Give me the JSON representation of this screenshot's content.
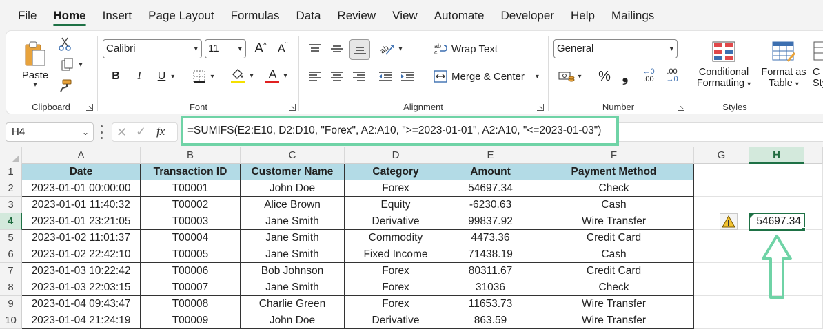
{
  "menu": {
    "items": [
      {
        "label": "File",
        "active": false
      },
      {
        "label": "Home",
        "active": true
      },
      {
        "label": "Insert",
        "active": false
      },
      {
        "label": "Page Layout",
        "active": false
      },
      {
        "label": "Formulas",
        "active": false
      },
      {
        "label": "Data",
        "active": false
      },
      {
        "label": "Review",
        "active": false
      },
      {
        "label": "View",
        "active": false
      },
      {
        "label": "Automate",
        "active": false
      },
      {
        "label": "Developer",
        "active": false
      },
      {
        "label": "Help",
        "active": false
      },
      {
        "label": "Mailings",
        "active": false
      }
    ]
  },
  "ribbon": {
    "clipboard": {
      "label": "Clipboard",
      "paste": "Paste"
    },
    "font": {
      "label": "Font",
      "family": "Calibri",
      "size": "11",
      "bold": "B",
      "italic": "I",
      "underline": "U",
      "grow": "A",
      "shrink": "A",
      "font_color": "A"
    },
    "alignment": {
      "label": "Alignment",
      "wrap_text": "Wrap Text",
      "merge_center": "Merge & Center"
    },
    "number": {
      "label": "Number",
      "format": "General",
      "percent": "%",
      "comma": "❟",
      "inc_decimal": ".00",
      "dec_decimal": ".00"
    },
    "styles": {
      "label": "Styles",
      "conditional_1": "Conditional",
      "conditional_2": "Formatting",
      "format_table_1": "Format as",
      "format_table_2": "Table",
      "cell_styles_1": "C",
      "cell_styles_2": "Styl"
    }
  },
  "formula_bar": {
    "name_box": "H4",
    "fx": "fx",
    "formula": "=SUMIFS(E2:E10, D2:D10, \"Forex\", A2:A10, \">=2023-01-01\", A2:A10, \"<=2023-01-03\")"
  },
  "sheet": {
    "columns": [
      "A",
      "B",
      "C",
      "D",
      "E",
      "F",
      "G",
      "H"
    ],
    "selected_column": "H",
    "rows": [
      "1",
      "2",
      "3",
      "4",
      "5",
      "6",
      "7",
      "8",
      "9",
      "10"
    ],
    "selected_row": "4",
    "table_headers": [
      "Date",
      "Transaction ID",
      "Customer Name",
      "Category",
      "Amount",
      "Payment Method"
    ],
    "table_rows": [
      [
        "2023-01-01 00:00:00",
        "T00001",
        "John Doe",
        "Forex",
        "54697.34",
        "Check"
      ],
      [
        "2023-01-01 11:40:32",
        "T00002",
        "Alice Brown",
        "Equity",
        "-6230.63",
        "Cash"
      ],
      [
        "2023-01-01 23:21:05",
        "T00003",
        "Jane Smith",
        "Derivative",
        "99837.92",
        "Wire Transfer"
      ],
      [
        "2023-01-02 11:01:37",
        "T00004",
        "Jane Smith",
        "Commodity",
        "4473.36",
        "Credit Card"
      ],
      [
        "2023-01-02 22:42:10",
        "T00005",
        "Jane Smith",
        "Fixed Income",
        "71438.19",
        "Cash"
      ],
      [
        "2023-01-03 10:22:42",
        "T00006",
        "Bob Johnson",
        "Forex",
        "80311.67",
        "Credit Card"
      ],
      [
        "2023-01-03 22:03:15",
        "T00007",
        "Jane Smith",
        "Forex",
        "31036",
        "Check"
      ],
      [
        "2023-01-04 09:43:47",
        "T00008",
        "Charlie Green",
        "Forex",
        "11653.73",
        "Wire Transfer"
      ],
      [
        "2023-01-04 21:24:19",
        "T00009",
        "John Doe",
        "Derivative",
        "863.59",
        "Wire Transfer"
      ]
    ],
    "result_cell_value": "54697.34"
  },
  "colors": {
    "accent": "#1e7145",
    "header_fill": "#b3dbe6",
    "highlight": "#6fd3a6"
  }
}
